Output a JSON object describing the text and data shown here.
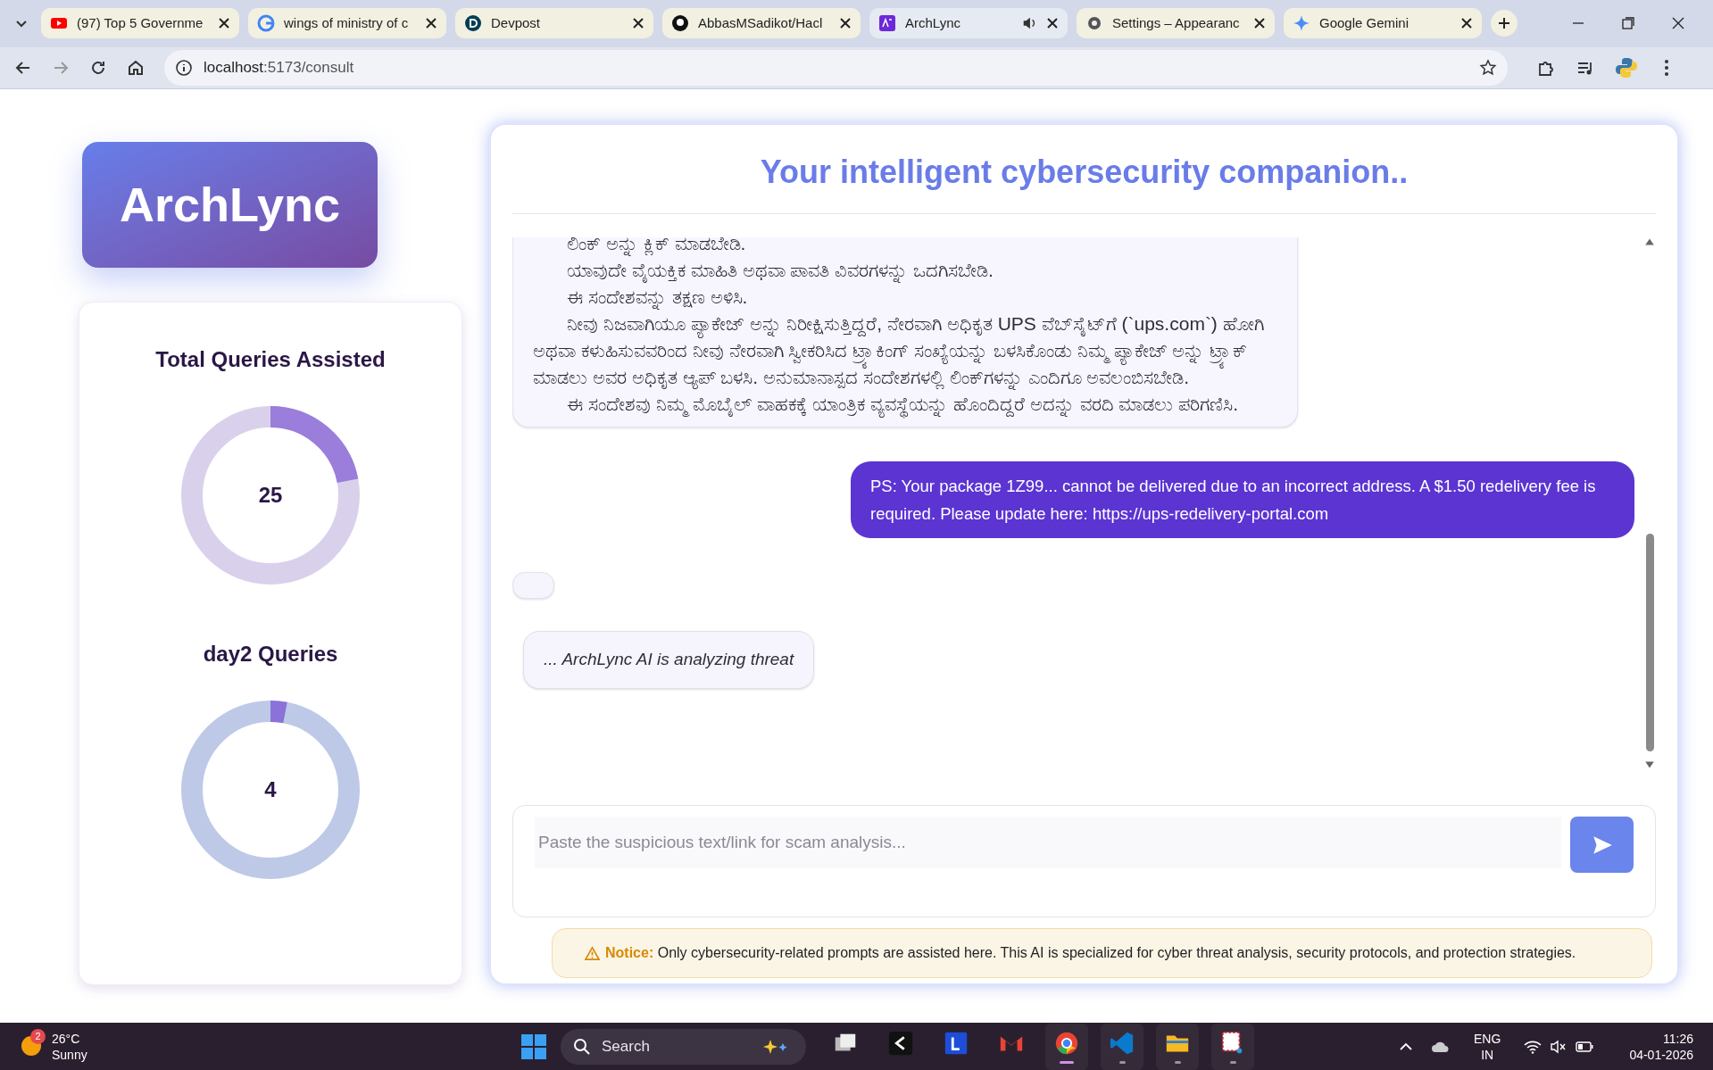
{
  "browser": {
    "tabs": [
      {
        "title": "(97) Top 5 Governme",
        "kind": "youtube",
        "selected": false,
        "audio": false
      },
      {
        "title": "wings of ministry of c",
        "kind": "google",
        "selected": false,
        "audio": false
      },
      {
        "title": "Devpost",
        "kind": "devpost",
        "selected": false,
        "audio": false
      },
      {
        "title": "AbbasMSadikot/Hacl",
        "kind": "github",
        "selected": false,
        "audio": false
      },
      {
        "title": "ArchLync",
        "kind": "app",
        "selected": true,
        "audio": true
      },
      {
        "title": "Settings – Appearanc",
        "kind": "settings",
        "selected": false,
        "audio": false
      },
      {
        "title": "Google Gemini",
        "kind": "gemini",
        "selected": false,
        "audio": false
      }
    ],
    "address": {
      "host": "localhost",
      "path": ":5173/consult"
    }
  },
  "logo": "ArchLync",
  "stats": [
    {
      "title": "Total Queries Assisted",
      "value": "25",
      "level": 0.22
    },
    {
      "title": "day2 Queries",
      "value": "4",
      "level": 0.03
    }
  ],
  "chat": {
    "title": "Your intelligent cybersecurity companion..",
    "messages": [
      {
        "kind": "bot",
        "paragraphs": [
          "ಲಿಂಕ್ ಅನ್ನು ಕ್ಲಿಕ್ ಮಾಡಬೇಡಿ.",
          "ಯಾವುದೇ ವೈಯಕ್ತಿಕ ಮಾಹಿತಿ ಅಥವಾ ಪಾವತಿ ವಿವರಗಳನ್ನು ಒದಗಿಸಬೇಡಿ.",
          "ಈ ಸಂದೇಶವನ್ನು ತಕ್ಷಣ ಅಳಿಸಿ.",
          "ನೀವು ನಿಜವಾಗಿಯೂ ಪ್ಯಾಕೇಜ್ ಅನ್ನು ನಿರೀಕ್ಷಿಸುತ್ತಿದ್ದರೆ, ನೇರವಾಗಿ ಅಧಿಕೃತ UPS ವೆಬ್‌ಸೈಟ್‌ಗೆ (`ups.com`) ಹೋಗಿ ಅಥವಾ ಕಳುಹಿಸುವವರಿಂದ ನೀವು ನೇರವಾಗಿ ಸ್ವೀಕರಿಸಿದ ಟ್ರ್ಯಾಕಿಂಗ್ ಸಂಖ್ಯೆಯನ್ನು ಬಳಸಿಕೊಂಡು ನಿಮ್ಮ ಪ್ಯಾಕೇಜ್ ಅನ್ನು ಟ್ರ್ಯಾಕ್ ಮಾಡಲು ಅವರ ಅಧಿಕೃತ ಆ್ಯಪ್ ಬಳಸಿ. ಅನುಮಾನಾಸ್ಪದ ಸಂದೇಶಗಳಲ್ಲಿ ಲಿಂಕ್‌ಗಳನ್ನು ಎಂದಿಗೂ ಅವಲಂಬಿಸಬೇಡಿ.",
          "ಈ ಸಂದೇಶವು ನಿಮ್ಮ ಮೊಬೈಲ್ ವಾಹಕಕ್ಕೆ ಯಾಂತ್ರಿಕ ವ್ಯವಸ್ಥೆಯನ್ನು ಹೊಂದಿದ್ದರೆ ಅದನ್ನು ವರದಿ ಮಾಡಲು ಪರಿಗಣಿಸಿ."
        ]
      },
      {
        "kind": "user",
        "text": "PS: Your package 1Z99... cannot be delivered due to an incorrect address. A $1.50 redelivery fee is required. Please update here: https://ups-redelivery-portal.com"
      },
      {
        "kind": "empty"
      },
      {
        "kind": "typing",
        "text": "... ArchLync AI is analyzing threat"
      }
    ],
    "input": {
      "placeholder": "Paste the suspicious text/link for scam analysis..."
    },
    "notice": {
      "label": "Notice:",
      "text": "Only cybersecurity-related prompts are assisted here. This AI is specialized for cyber threat analysis, security protocols, and protection strategies."
    }
  },
  "taskbar": {
    "weather": {
      "temp": "26°C",
      "condition": "Sunny",
      "badge": "2"
    },
    "search": "Search",
    "apps": [
      {
        "kind": "taskview",
        "running": false
      },
      {
        "kind": "terminal",
        "running": false
      },
      {
        "kind": "l",
        "running": false
      },
      {
        "kind": "mail",
        "running": false
      },
      {
        "kind": "chrome",
        "running": true
      },
      {
        "kind": "vscode",
        "running": true
      },
      {
        "kind": "folder",
        "running": true
      },
      {
        "kind": "snip",
        "running": true
      }
    ],
    "language": [
      "ENG",
      "IN"
    ],
    "time": "11:26",
    "date": "04-01-2026"
  }
}
